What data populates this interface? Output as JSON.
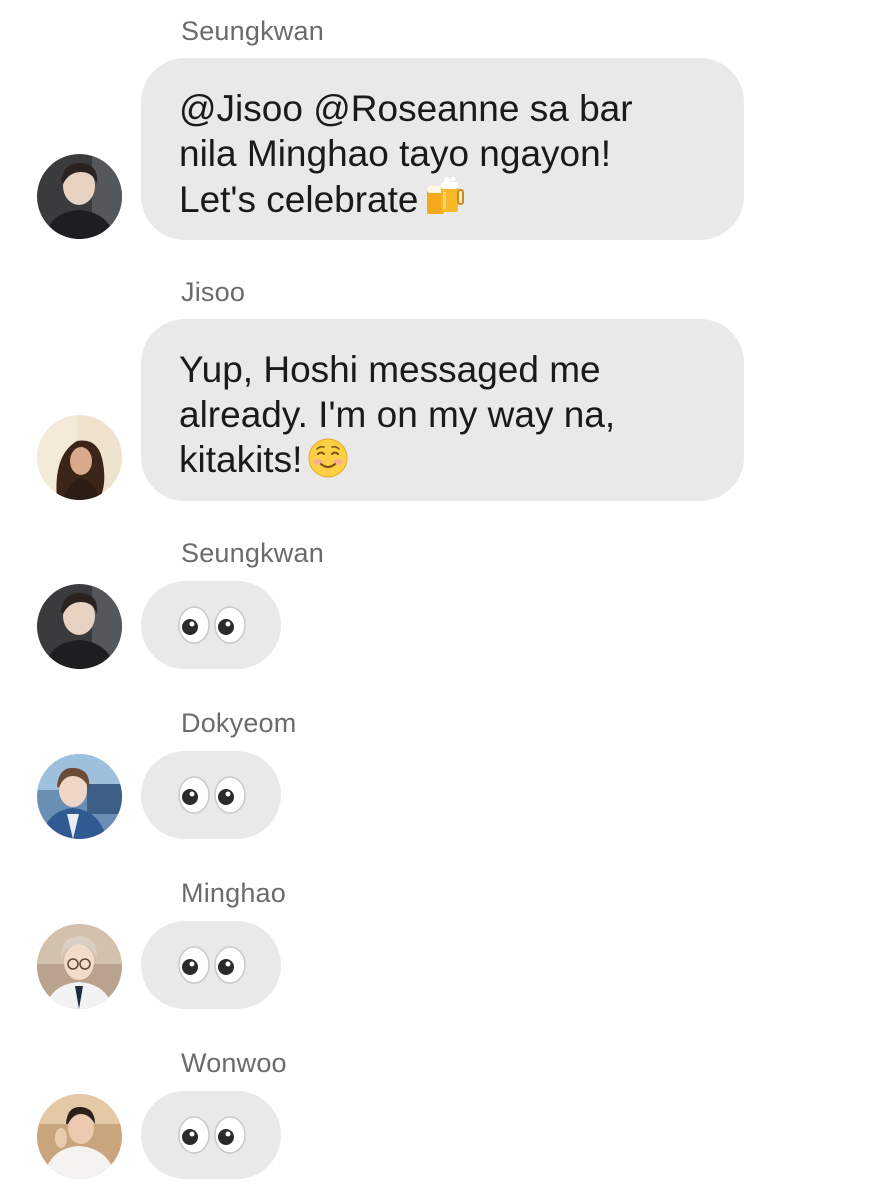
{
  "messages": [
    {
      "sender": "Seungkwan",
      "text": "@Jisoo @Roseanne sa bar\nnila Minghao tayo ngayon!\nLet's celebrate",
      "emoji": "beer-mugs-icon"
    },
    {
      "sender": "Jisoo",
      "text": "Yup, Hoshi messaged me\nalready. I'm on my way na,\nkitakits!",
      "emoji": "smiling-face-icon"
    },
    {
      "sender": "Seungkwan",
      "emoji": "eyes-icon"
    },
    {
      "sender": "Dokyeom",
      "emoji": "eyes-icon"
    },
    {
      "sender": "Minghao",
      "emoji": "eyes-icon"
    },
    {
      "sender": "Wonwoo",
      "emoji": "eyes-icon"
    }
  ],
  "colors": {
    "bubble": "#e9e9e9",
    "sender_name": "#6b6b6b",
    "text": "#1a1a1a",
    "background": "#ffffff"
  }
}
